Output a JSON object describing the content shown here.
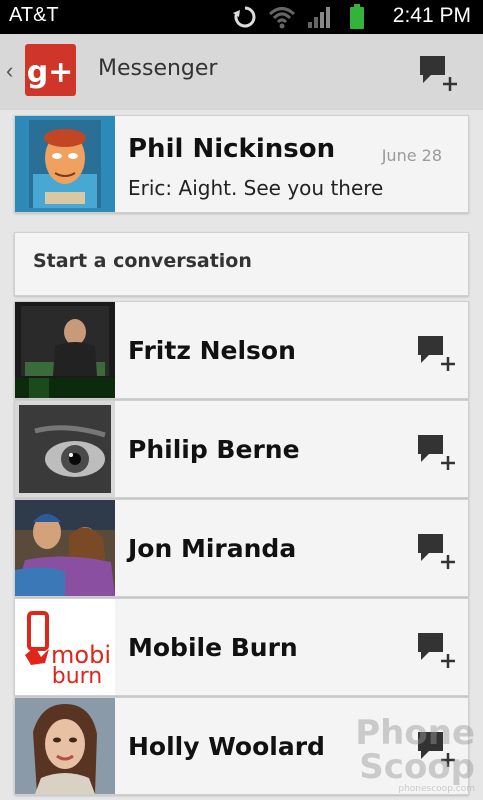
{
  "status_bar": {
    "carrier": "AT&T",
    "time": "2:41 PM"
  },
  "action_bar": {
    "title": "Messenger",
    "back_glyph": "‹",
    "logo_text": "g+",
    "compose_icon": "new-message-icon"
  },
  "recent_thread": {
    "name": "Phil Nickinson",
    "date": "June 28",
    "snippet": "Eric: Aight. See you there"
  },
  "section_header": "Start a conversation",
  "contacts": [
    {
      "name": "Fritz Nelson"
    },
    {
      "name": "Philip Berne"
    },
    {
      "name": "Jon Miranda"
    },
    {
      "name": "Mobile Burn",
      "logo_text_top": "mobi",
      "logo_text_bottom": "burn"
    },
    {
      "name": "Holly Woolard"
    }
  ],
  "watermark": {
    "line1": "Phone",
    "line2": "Scoop",
    "footer": "phonescoop.com"
  },
  "colors": {
    "gplus_red": "#d0352a",
    "mobileburn_red": "#e0251b",
    "battery_green": "#33b33a"
  }
}
